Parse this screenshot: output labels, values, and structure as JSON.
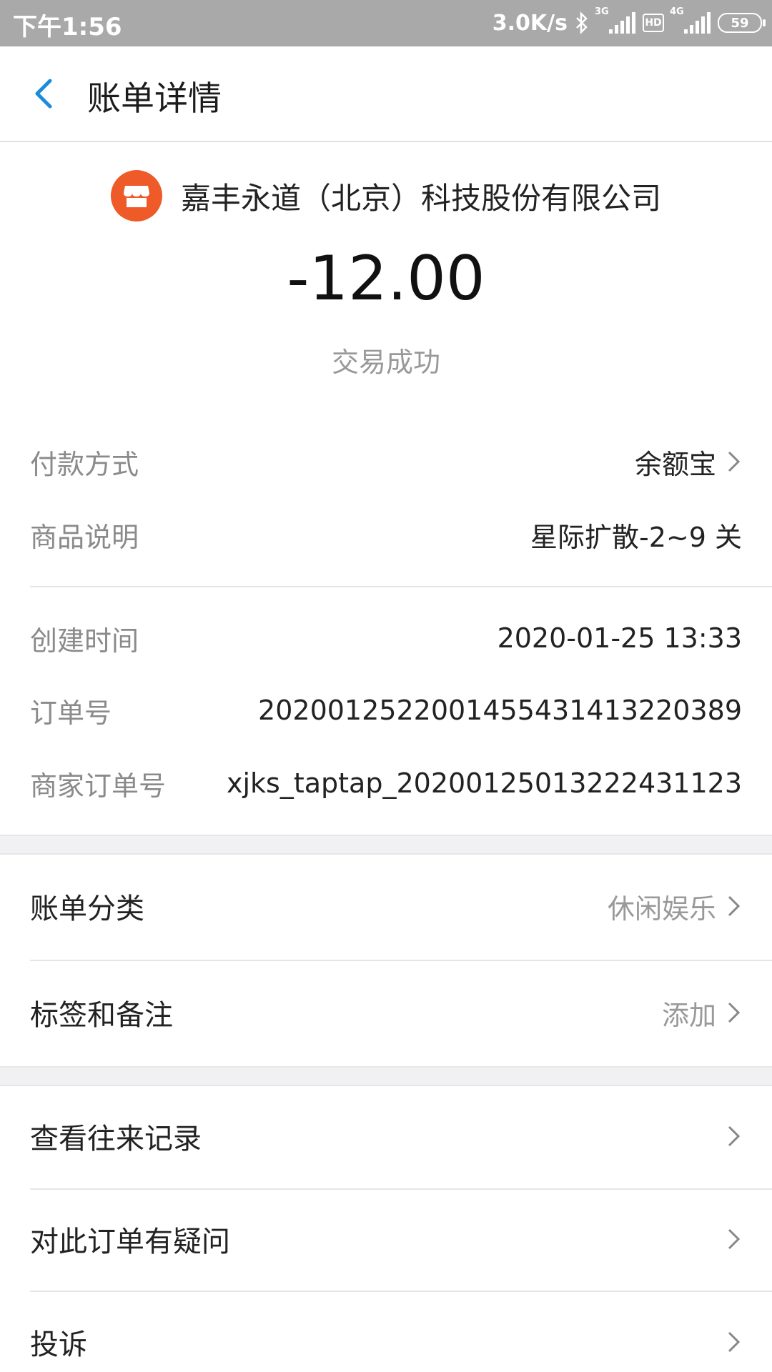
{
  "status_bar": {
    "time": "下午1:56",
    "network_speed": "3.0K/s",
    "signal_3g": "3G",
    "hd": "HD",
    "signal_4g": "4G",
    "battery": "59"
  },
  "navbar": {
    "title": "账单详情",
    "back_icon": "chevron-left-icon"
  },
  "merchant": {
    "name": "嘉丰永道（北京）科技股份有限公司",
    "logo_icon": "store-icon",
    "logo_color": "#ee5a28"
  },
  "amount": "-12.00",
  "status": "交易成功",
  "details": [
    {
      "label": "付款方式",
      "value": "余额宝",
      "chevron": true
    },
    {
      "label": "商品说明",
      "value": "星际扩散-2~9 关",
      "chevron": false
    },
    {
      "label": "创建时间",
      "value": "2020-01-25 13:33",
      "chevron": false
    },
    {
      "label": "订单号",
      "value": "2020012522001455431413220389",
      "chevron": false
    },
    {
      "label": "商家订单号",
      "value": "xjks_taptap_20200125013222431123",
      "chevron": false
    }
  ],
  "category": {
    "label": "账单分类",
    "value": "休闲娱乐"
  },
  "tags": {
    "label": "标签和备注",
    "value": "添加"
  },
  "actions": [
    {
      "label": "查看往来记录"
    },
    {
      "label": "对此订单有疑问"
    },
    {
      "label": "投诉"
    }
  ],
  "accent_color": "#1a8cdb"
}
